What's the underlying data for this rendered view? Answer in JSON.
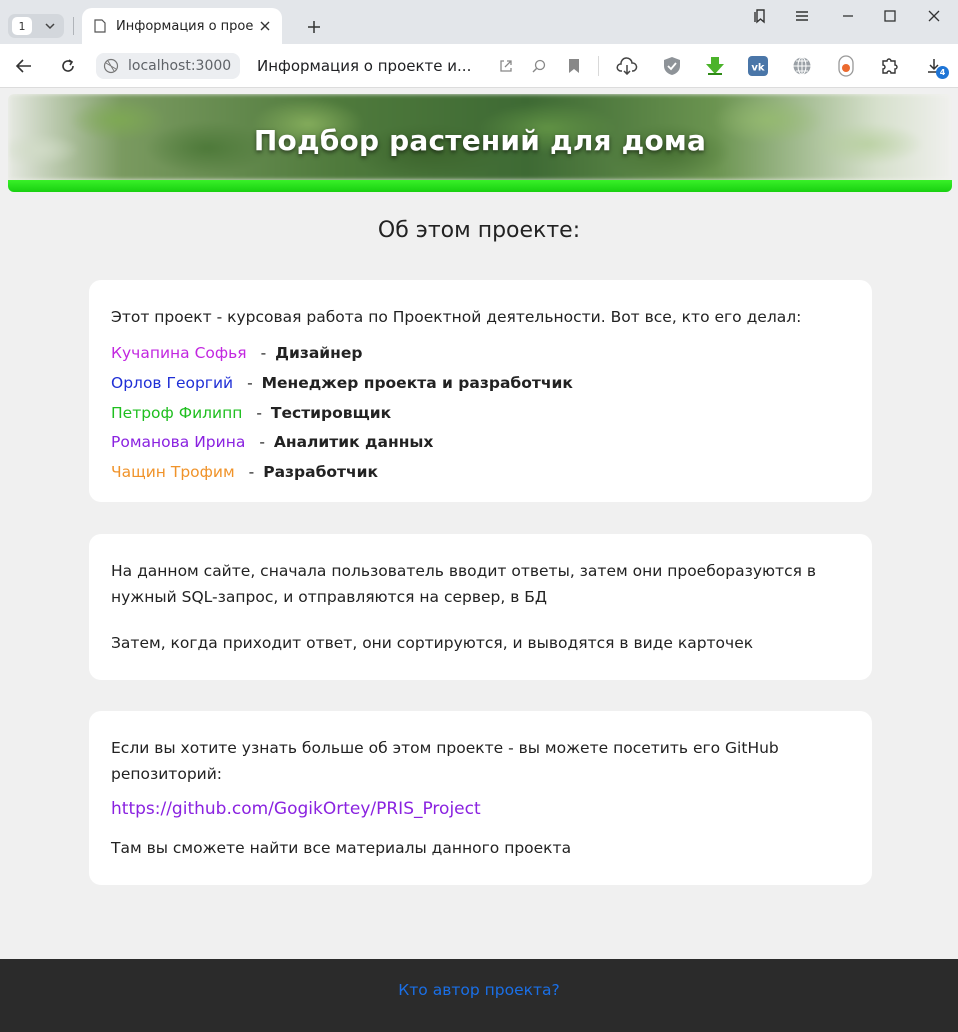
{
  "browser": {
    "tab_count": "1",
    "tab_title": "Информация о проекте",
    "address": "localhost:3000",
    "page_title": "Информация о проекте и...",
    "download_badge": "4"
  },
  "hero": {
    "title": "Подбор растений для дома"
  },
  "section": {
    "title": "Об этом проекте:"
  },
  "team": {
    "intro": "Этот проект - курсовая работа по Проектной деятельности. Вот все, кто его делал:",
    "separator": "-",
    "members": [
      {
        "name": "Кучапина Софья",
        "role": "Дизайнер",
        "color": "#c227e0"
      },
      {
        "name": "Орлов Георгий",
        "role": "Менеджер проекта и разработчик",
        "color": "#1f2fd6"
      },
      {
        "name": "Петроф Филипп",
        "role": "Тестировщик",
        "color": "#1fbf1f"
      },
      {
        "name": "Романова Ирина",
        "role": "Аналитик данных",
        "color": "#8a22e0"
      },
      {
        "name": "Чащин Трофим",
        "role": "Разработчик",
        "color": "#f0932a"
      }
    ]
  },
  "workflow": {
    "line1": "На данном сайте, сначала пользователь вводит ответы, затем они проеборазуются в",
    "line2": "нужный SQL-запрос, и отправляются на сервер, в БД",
    "line3": "Затем, когда приходит ответ, они сортируются, и выводятся в виде карточек"
  },
  "github": {
    "line1": "Если вы хотите узнать больше об этом проекте - вы можете посетить его GitHub",
    "line2": "репозиторий:",
    "link": "https://github.com/GogikOrtey/PRIS_Project",
    "outro": "Там вы сможете найти все материалы данного проекта"
  },
  "footer": {
    "link": "Кто автор проекта?"
  }
}
